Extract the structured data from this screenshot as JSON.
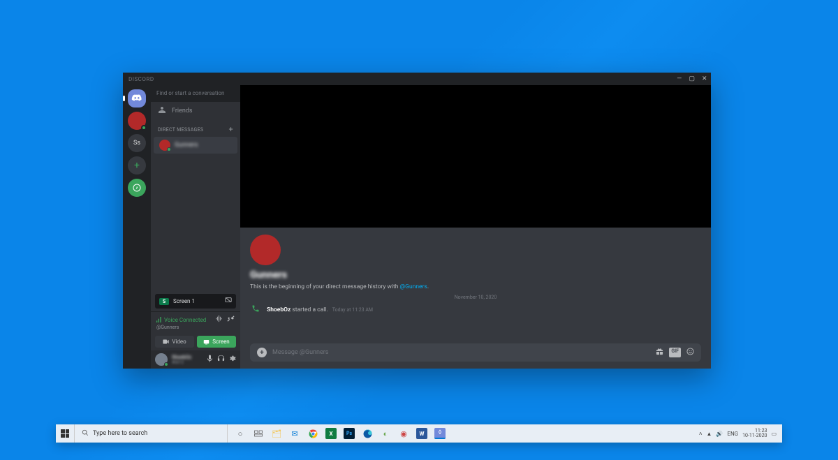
{
  "window": {
    "title": "DISCORD"
  },
  "sidebar": {
    "search_placeholder": "Find or start a conversation",
    "friends_label": "Friends",
    "dm_header": "DIRECT MESSAGES",
    "dm": {
      "name": "Gunners"
    },
    "screen_share": {
      "label": "Screen 1"
    },
    "voice": {
      "status": "Voice Connected",
      "channel": "@Gunners"
    },
    "video_btn": "Video",
    "screen_btn": "Screen",
    "user": {
      "name": "ShoebOz",
      "tag": "#0012"
    },
    "servers": {
      "ss": "Ss"
    }
  },
  "chat": {
    "channel_name": "Gunners",
    "history_prefix": "This is the beginning of your direct message history with ",
    "history_mention": "@Gunners",
    "history_suffix": ".",
    "divider_date": "November 10, 2020",
    "call": {
      "user": "ShoebOz",
      "action": "started a call.",
      "time": "Today at 11:23 AM"
    },
    "composer_placeholder": "Message @Gunners"
  },
  "taskbar": {
    "search_placeholder": "Type here to search",
    "lang": "ENG",
    "time": "11:23",
    "date": "10-11-2020"
  }
}
